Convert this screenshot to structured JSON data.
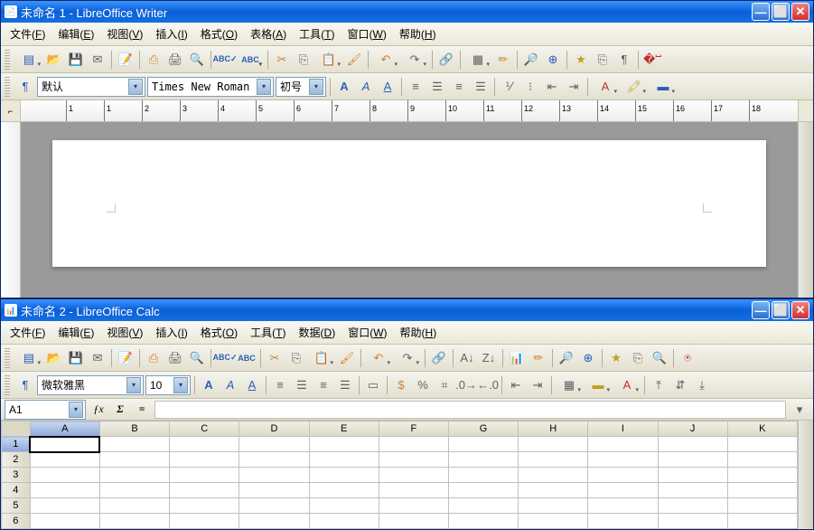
{
  "writer": {
    "title": "未命名 1 - LibreOffice Writer",
    "menus": [
      {
        "label": "文件",
        "key": "F"
      },
      {
        "label": "编辑",
        "key": "E"
      },
      {
        "label": "视图",
        "key": "V"
      },
      {
        "label": "插入",
        "key": "I"
      },
      {
        "label": "格式",
        "key": "O"
      },
      {
        "label": "表格",
        "key": "A"
      },
      {
        "label": "工具",
        "key": "T"
      },
      {
        "label": "窗口",
        "key": "W"
      },
      {
        "label": "帮助",
        "key": "H"
      }
    ],
    "style_combo": "默认",
    "font_combo": "Times New Roman",
    "size_combo": "初号",
    "ruler_marks": [
      -1,
      1,
      2,
      3,
      4,
      5,
      6,
      7,
      8,
      9,
      10,
      11,
      12,
      13,
      14,
      15,
      16,
      17,
      18
    ]
  },
  "calc": {
    "title": "未命名 2 - LibreOffice Calc",
    "menus": [
      {
        "label": "文件",
        "key": "F"
      },
      {
        "label": "编辑",
        "key": "E"
      },
      {
        "label": "视图",
        "key": "V"
      },
      {
        "label": "插入",
        "key": "I"
      },
      {
        "label": "格式",
        "key": "O"
      },
      {
        "label": "工具",
        "key": "T"
      },
      {
        "label": "数据",
        "key": "D"
      },
      {
        "label": "窗口",
        "key": "W"
      },
      {
        "label": "帮助",
        "key": "H"
      }
    ],
    "font_combo": "微软雅黑",
    "size_combo": "10",
    "name_box": "A1",
    "sigma": "Σ",
    "eq": "=",
    "columns": [
      "A",
      "B",
      "C",
      "D",
      "E",
      "F",
      "G",
      "H",
      "I",
      "J",
      "K"
    ],
    "rows": [
      1,
      2,
      3,
      4,
      5,
      6
    ],
    "active_cell": {
      "row": 1,
      "col": "A"
    }
  }
}
